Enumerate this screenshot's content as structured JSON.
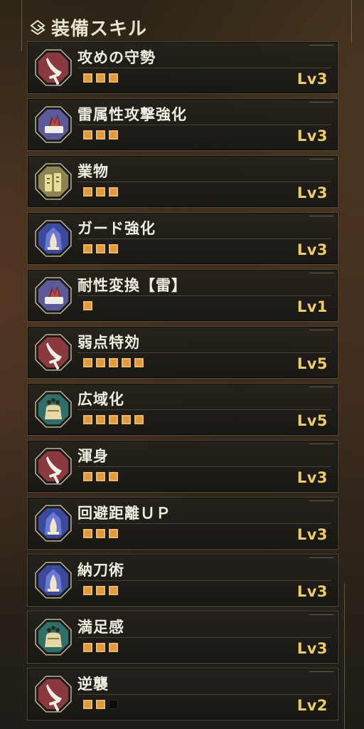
{
  "panel": {
    "title": "装備スキル"
  },
  "skills": [
    {
      "name": "攻めの守勢",
      "level_label": "Lv3",
      "level": 3,
      "max_level": 3,
      "icon": "sword-icon",
      "color": "#8a3a3f"
    },
    {
      "name": "雷属性攻撃強化",
      "level_label": "Lv3",
      "level": 3,
      "max_level": 3,
      "icon": "thunder-element-icon",
      "color": "#5b5a9a"
    },
    {
      "name": "業物",
      "level_label": "Lv3",
      "level": 3,
      "max_level": 3,
      "icon": "whetstone-icon",
      "color": "#8e8452"
    },
    {
      "name": "ガード強化",
      "level_label": "Lv3",
      "level": 3,
      "max_level": 3,
      "icon": "guard-icon",
      "color": "#3b4a9a"
    },
    {
      "name": "耐性変換【雷】",
      "level_label": "Lv1",
      "level": 1,
      "max_level": 1,
      "icon": "thunder-element-icon",
      "color": "#5b5a9a"
    },
    {
      "name": "弱点特効",
      "level_label": "Lv5",
      "level": 5,
      "max_level": 5,
      "icon": "sword-icon",
      "color": "#8a3a3f"
    },
    {
      "name": "広域化",
      "level_label": "Lv5",
      "level": 5,
      "max_level": 5,
      "icon": "item-bag-icon",
      "color": "#2e6f6a"
    },
    {
      "name": "渾身",
      "level_label": "Lv3",
      "level": 3,
      "max_level": 3,
      "icon": "sword-icon",
      "color": "#8a3a3f"
    },
    {
      "name": "回避距離ＵＰ",
      "level_label": "Lv3",
      "level": 3,
      "max_level": 3,
      "icon": "guard-icon",
      "color": "#3b4a9a"
    },
    {
      "name": "納刀術",
      "level_label": "Lv3",
      "level": 3,
      "max_level": 3,
      "icon": "guard-icon",
      "color": "#3b4a9a"
    },
    {
      "name": "満足感",
      "level_label": "Lv3",
      "level": 3,
      "max_level": 3,
      "icon": "item-bag-icon",
      "color": "#2e6f6a"
    },
    {
      "name": "逆襲",
      "level_label": "Lv2",
      "level": 2,
      "max_level": 3,
      "icon": "sword-icon",
      "color": "#8a3a3f"
    }
  ]
}
